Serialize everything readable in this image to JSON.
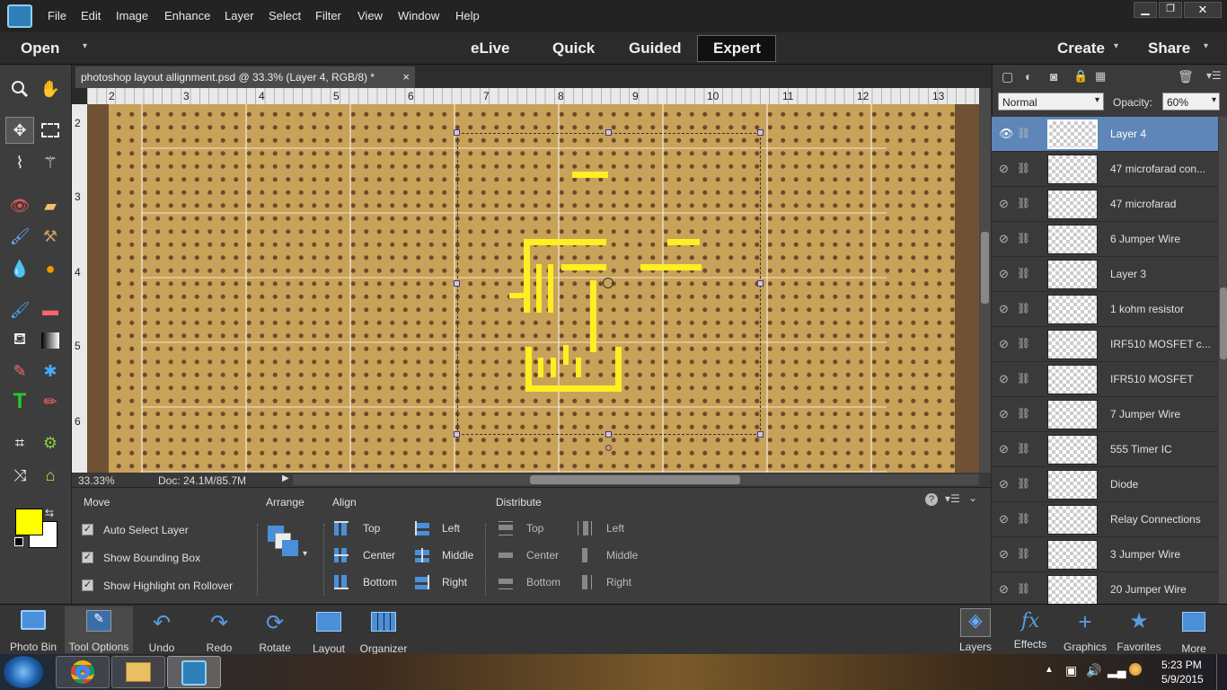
{
  "app": {
    "menus": [
      "File",
      "Edit",
      "Image",
      "Enhance",
      "Layer",
      "Select",
      "Filter",
      "View",
      "Window",
      "Help"
    ],
    "modes": {
      "open": "Open",
      "elive": "eLive",
      "quick": "Quick",
      "guided": "Guided",
      "expert": "Expert",
      "create": "Create",
      "share": "Share"
    }
  },
  "document": {
    "tab_title": "photoshop layout allignment.psd @ 33.3% (Layer 4, RGB/8) *",
    "close": "×",
    "zoom": "33.33%",
    "doc_info": "Doc: 24.1M/85.7M",
    "ruler_h": [
      "2",
      "3",
      "4",
      "5",
      "6",
      "7",
      "8",
      "9",
      "10",
      "11",
      "12",
      "13"
    ],
    "ruler_v": [
      "2",
      "3",
      "4",
      "5",
      "6"
    ]
  },
  "tool_options": {
    "move_title": "Move",
    "auto_select": "Auto Select Layer",
    "show_bbox": "Show Bounding Box",
    "show_highlight": "Show Highlight on Rollover",
    "arrange_title": "Arrange",
    "align_title": "Align",
    "align_top": "Top",
    "align_center": "Center",
    "align_bottom": "Bottom",
    "align_left": "Left",
    "align_middle": "Middle",
    "align_right": "Right",
    "distribute_title": "Distribute",
    "dist_top": "Top",
    "dist_center": "Center",
    "dist_bottom": "Bottom",
    "dist_left": "Left",
    "dist_middle": "Middle",
    "dist_right": "Right"
  },
  "layers": {
    "blend_mode": "Normal",
    "opacity_label": "Opacity:",
    "opacity": "60%",
    "items": [
      {
        "name": "Layer 4"
      },
      {
        "name": "47 microfarad con..."
      },
      {
        "name": "47 microfarad"
      },
      {
        "name": "6 Jumper Wire"
      },
      {
        "name": "Layer 3"
      },
      {
        "name": "1 kohm resistor"
      },
      {
        "name": "IRF510 MOSFET c..."
      },
      {
        "name": "IFR510 MOSFET"
      },
      {
        "name": "7 Jumper Wire"
      },
      {
        "name": "555 Timer IC"
      },
      {
        "name": "Diode"
      },
      {
        "name": "Relay Connections"
      },
      {
        "name": "3 Jumper Wire"
      },
      {
        "name": "20 Jumper Wire"
      }
    ]
  },
  "bottom_left": {
    "photo_bin": "Photo Bin",
    "tool_options": "Tool Options",
    "undo": "Undo",
    "redo": "Redo",
    "rotate": "Rotate",
    "layout": "Layout",
    "organizer": "Organizer"
  },
  "bottom_right": {
    "layers": "Layers",
    "effects": "Effects",
    "graphics": "Graphics",
    "favorites": "Favorites",
    "more": "More"
  },
  "taskbar": {
    "time": "5:23 PM",
    "date": "5/9/2015"
  },
  "colors": {
    "foreground": "#ffff00",
    "background": "#ffffff",
    "selected_layer": "#5e86b8",
    "board": "#c9a25a"
  }
}
